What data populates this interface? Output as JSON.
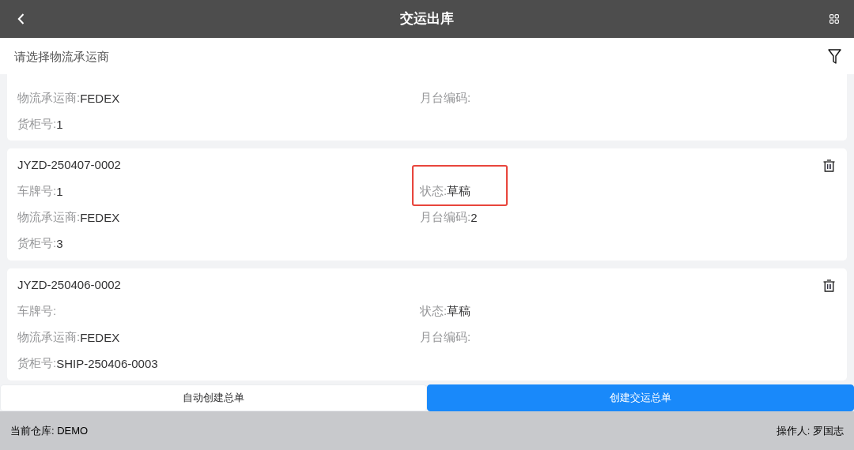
{
  "header": {
    "title": "交运出库"
  },
  "filter": {
    "placeholder": "请选择物流承运商"
  },
  "orders": [
    {
      "fields": [
        {
          "label": "物流承运商:",
          "value": "FEDEX",
          "highlighted": false
        },
        {
          "label": "月台编码:",
          "highlighted": false
        },
        {
          "label": "货柜号:",
          "value": "1",
          "highlighted": false
        }
      ]
    },
    {
      "number": "JYZD-250407-0002",
      "fields": [
        {
          "label": "车牌号:",
          "value": "1",
          "highlighted": false
        },
        {
          "label": "状态:",
          "value": "草稿",
          "highlighted": true
        },
        {
          "label": "物流承运商:",
          "value": "FEDEX",
          "highlighted": false
        },
        {
          "label": "月台编码:",
          "value": "2",
          "highlighted": false
        },
        {
          "label": "货柜号:",
          "value": "3",
          "highlighted": false
        }
      ]
    },
    {
      "number": "JYZD-250406-0002",
      "fields": [
        {
          "label": "车牌号:",
          "highlighted": false
        },
        {
          "label": "状态:",
          "value": "草稿",
          "highlighted": false
        },
        {
          "label": "物流承运商:",
          "value": "FEDEX",
          "highlighted": false
        },
        {
          "label": "月台编码:",
          "highlighted": false
        },
        {
          "label": "货柜号:",
          "value": "SHIP-250406-0003",
          "highlighted": false
        }
      ]
    }
  ],
  "actions": [
    {
      "label": "自动创建总单",
      "primary": false
    },
    {
      "label": "创建交运总单",
      "primary": true
    }
  ],
  "footer": {
    "warehouse": "当前仓库: DEMO",
    "operator": "操作人: 罗国志"
  }
}
